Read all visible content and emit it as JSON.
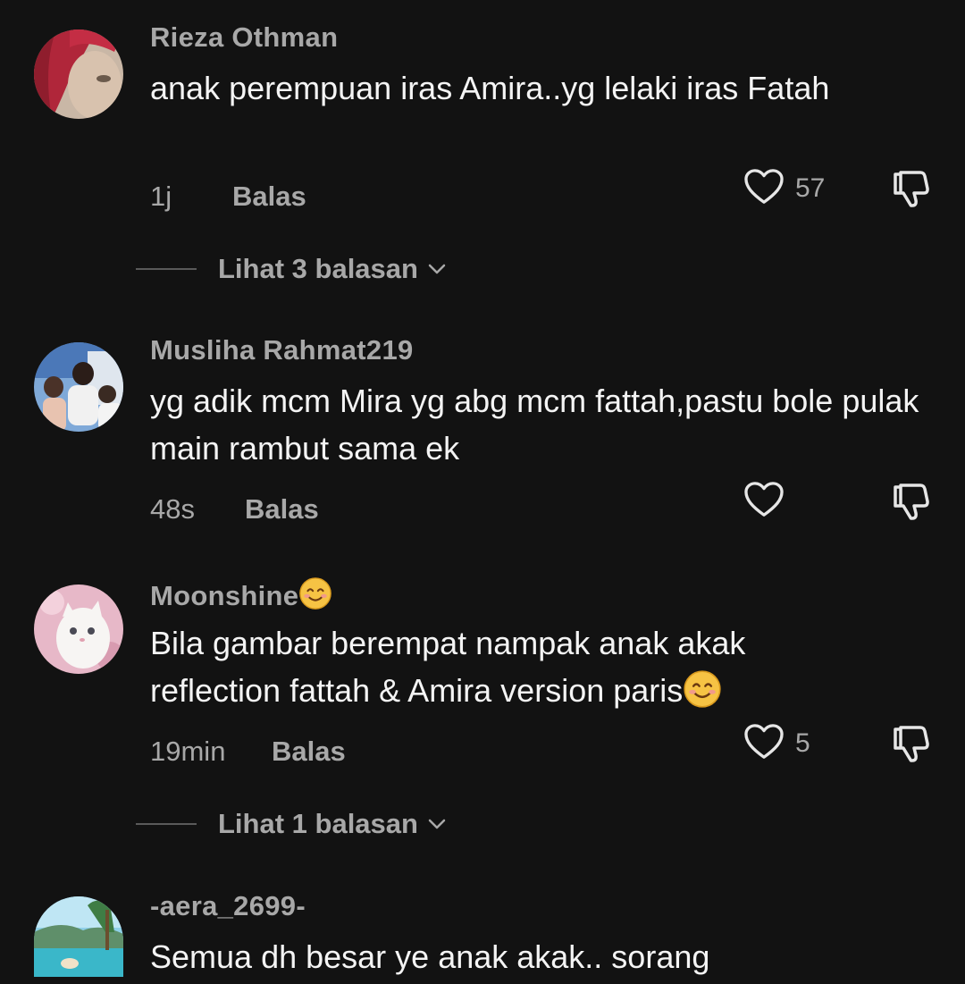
{
  "comments": [
    {
      "username": "Rieza Othman",
      "text": "anak perempuan iras Amira..yg lelaki iras Fatah",
      "time": "1j",
      "reply_label": "Balas",
      "likes": "57",
      "view_replies": "Lihat 3 balasan"
    },
    {
      "username": "Musliha Rahmat219",
      "text": "yg adik mcm Mira yg abg mcm fattah,pastu bole pulak main rambut sama ek",
      "time": "48s",
      "reply_label": "Balas"
    },
    {
      "username": "Moonshine",
      "text": "Bila gambar berempat nampak anak akak reflection fattah & Amira version paris",
      "time": "19min",
      "reply_label": "Balas",
      "likes": "5",
      "view_replies": "Lihat 1 balasan"
    },
    {
      "username": "-aera_2699-",
      "text": "Semua dh besar ye anak akak.. sorang"
    }
  ],
  "icons": {
    "like": "heart-outline-icon",
    "dislike": "thumbs-down-icon",
    "expand": "chevron-down-icon",
    "emoji": "smiling-face-emoji"
  },
  "colors": {
    "background": "#121212",
    "primary_text": "#f4f4f4",
    "secondary_text": "#a8a8a8",
    "divider": "#5a5a5a"
  }
}
